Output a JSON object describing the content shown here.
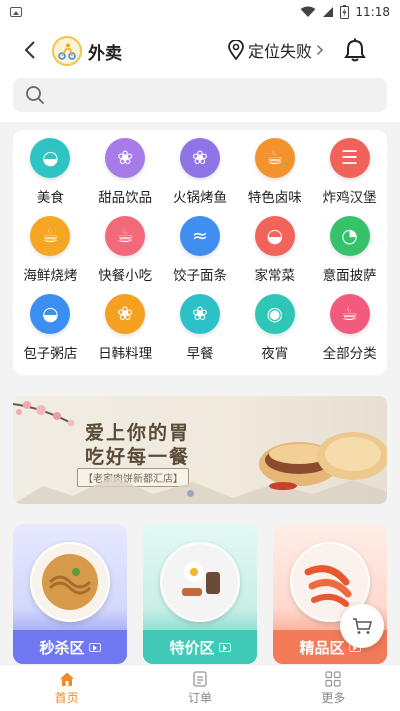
{
  "status_bar": {
    "time": "11:18"
  },
  "header": {
    "title": "外卖",
    "location": "定位失败"
  },
  "search": {
    "placeholder": ""
  },
  "categories": [
    {
      "label": "美食",
      "icon": "bowl-icon",
      "color": "#2fc4c4"
    },
    {
      "label": "甜品饮品",
      "icon": "cake-icon",
      "color": "#a77be8"
    },
    {
      "label": "火锅烤鱼",
      "icon": "fish-icon",
      "color": "#8f74e6"
    },
    {
      "label": "特色卤味",
      "icon": "chicken-icon",
      "color": "#f3932d"
    },
    {
      "label": "炸鸡汉堡",
      "icon": "burger-icon",
      "color": "#f0625a"
    },
    {
      "label": "海鲜烧烤",
      "icon": "beer-icon",
      "color": "#f5a623"
    },
    {
      "label": "快餐小吃",
      "icon": "fastfood-icon",
      "color": "#f26a7a"
    },
    {
      "label": "饺子面条",
      "icon": "noodle-icon",
      "color": "#3f8ef0"
    },
    {
      "label": "家常菜",
      "icon": "dish-icon",
      "color": "#f0645a"
    },
    {
      "label": "意面披萨",
      "icon": "pizza-icon",
      "color": "#36c26a"
    },
    {
      "label": "包子粥店",
      "icon": "pot-icon",
      "color": "#3a8ff0"
    },
    {
      "label": "日韩料理",
      "icon": "sushi-icon",
      "color": "#f4a122"
    },
    {
      "label": "早餐",
      "icon": "breakfast-icon",
      "color": "#2cc0c8"
    },
    {
      "label": "夜宵",
      "icon": "egg-icon",
      "color": "#2ec7b5"
    },
    {
      "label": "全部分类",
      "icon": "cup-icon",
      "color": "#f25b7e"
    }
  ],
  "banner": {
    "line1": "爱上你的胃",
    "line2": "吃好每一餐",
    "store": "【老家肉饼新都汇店】"
  },
  "promos": [
    {
      "label": "秒杀区",
      "color_top": "#dfe3ff",
      "color_bottom": "#6f78f0"
    },
    {
      "label": "特价区",
      "color_top": "#d9f6f1",
      "color_bottom": "#3ecab6"
    },
    {
      "label": "精品区",
      "color_top": "#ffe6de",
      "color_bottom": "#f47b5a"
    }
  ],
  "bottom_nav": [
    {
      "label": "首页",
      "active": true
    },
    {
      "label": "订单",
      "active": false
    },
    {
      "label": "更多",
      "active": false
    }
  ],
  "colors": {
    "accent": "#f08a24"
  }
}
